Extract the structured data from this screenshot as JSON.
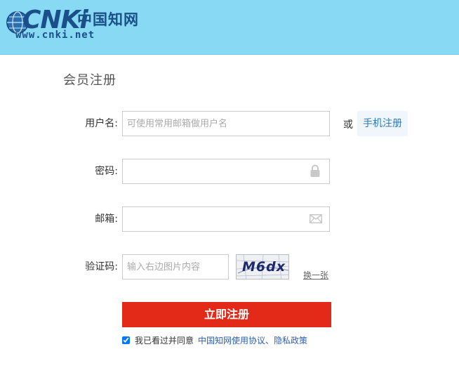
{
  "header": {
    "logo_main": "CNKi",
    "logo_cn": "中国知网",
    "logo_url": "www.cnki.net"
  },
  "form": {
    "title": "会员注册",
    "username_label": "用户名:",
    "username_placeholder": "可使用常用邮箱做用户名",
    "or_text": "或",
    "mobile_register": "手机注册",
    "password_label": "密码:",
    "email_label": "邮箱:",
    "captcha_label": "验证码:",
    "captcha_placeholder": "输入右边图片内容",
    "captcha_image_text": "M6dx",
    "refresh_link": "换一张",
    "submit_label": "立即注册",
    "agree_text": "我已看过并同意",
    "agree_link": "中国知网使用协议、隐私政策",
    "agree_checked": true
  },
  "colors": {
    "header_bg": "#87d9f4",
    "submit_bg": "#e32a18",
    "link": "#2d5fb3",
    "mobile_btn_bg": "#f0f6fb"
  },
  "icons": [
    "globe-icon",
    "lock-icon",
    "envelope-icon",
    "checkbox-icon"
  ]
}
